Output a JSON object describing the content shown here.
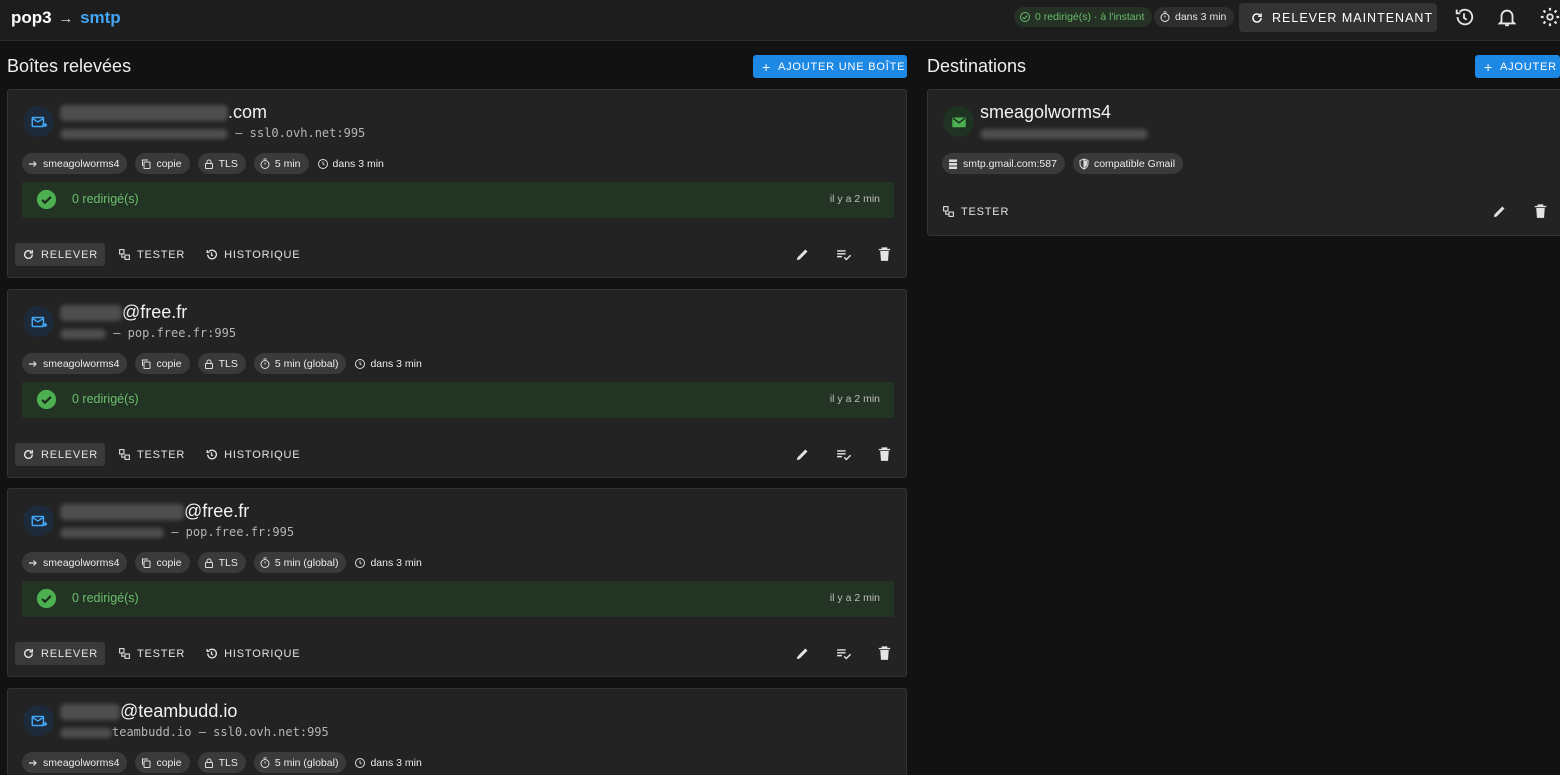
{
  "header": {
    "brand_from": "pop3",
    "brand_arrow": "→",
    "brand_to": "smtp",
    "status_summary": "0 redirigé(s) · à l'instant",
    "next_run": "dans 3 min",
    "relever_now_label": "RELEVER MAINTENANT"
  },
  "boxes_section": {
    "title": "Boîtes relevées",
    "add_label": "AJOUTER UNE BOÎTE",
    "actions": {
      "relever": "RELEVER",
      "tester": "TESTER",
      "historique": "HISTORIQUE"
    }
  },
  "boxes": [
    {
      "title_suffix": ".com",
      "server": "— ssl0.ovh.net:995",
      "destination": "smeagolworms4",
      "mode": "copie",
      "security": "TLS",
      "interval": "5 min",
      "next": "dans 3 min",
      "status_count": "0 redirigé(s)",
      "status_time": "il y a 2 min"
    },
    {
      "title_suffix": "@free.fr",
      "server": "— pop.free.fr:995",
      "destination": "smeagolworms4",
      "mode": "copie",
      "security": "TLS",
      "interval": "5 min (global)",
      "next": "dans 3 min",
      "status_count": "0 redirigé(s)",
      "status_time": "il y a 2 min"
    },
    {
      "title_suffix": "@free.fr",
      "server": "— pop.free.fr:995",
      "destination": "smeagolworms4",
      "mode": "copie",
      "security": "TLS",
      "interval": "5 min (global)",
      "next": "dans 3 min",
      "status_count": "0 redirigé(s)",
      "status_time": "il y a 2 min"
    },
    {
      "title_suffix": "@teambudd.io",
      "server": "teambudd.io — ssl0.ovh.net:995",
      "destination": "smeagolworms4",
      "mode": "copie",
      "security": "TLS",
      "interval": "5 min (global)",
      "next": "dans 3 min"
    }
  ],
  "destinations_section": {
    "title": "Destinations",
    "add_label": "AJOUTER"
  },
  "destinations": [
    {
      "name": "smeagolworms4",
      "smtp": "smtp.gmail.com:587",
      "compat": "compatible Gmail",
      "test_label": "TESTER"
    }
  ],
  "icons": {
    "box_avatar": "mail-forward-icon",
    "destination_avatar": "gmail-icon"
  },
  "colors": {
    "accent": "#42a5f5",
    "button_primary": "#1e88e5",
    "success": "#66bb6a",
    "success_bg": "#243424",
    "background": "#121212",
    "card": "#232323"
  }
}
